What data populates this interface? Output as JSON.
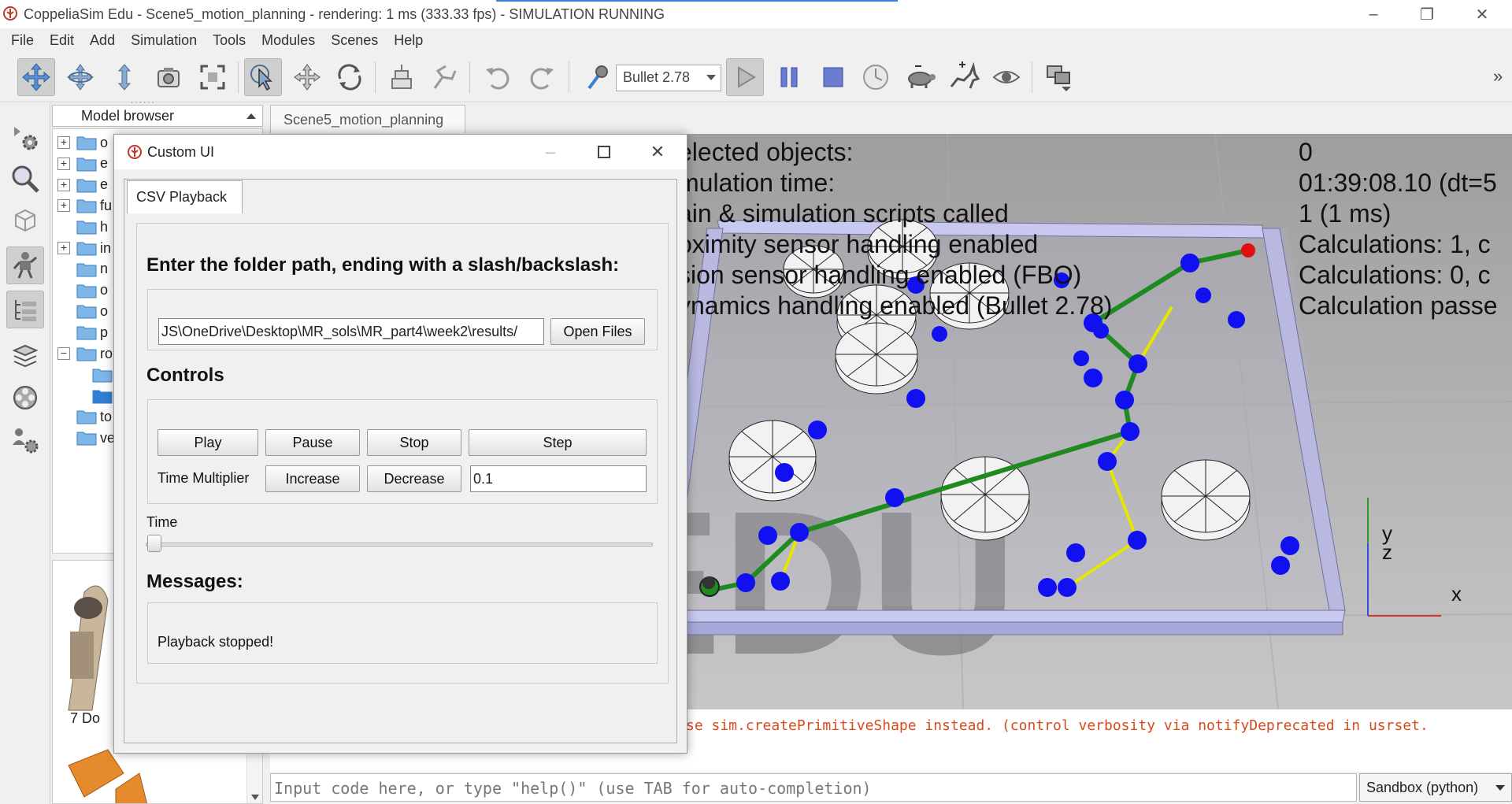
{
  "window": {
    "title": "CoppeliaSim Edu - Scene5_motion_planning - rendering: 1 ms (333.33 fps) - SIMULATION RUNNING",
    "minimize_glyph": "–",
    "restore_glyph": "❐",
    "close_glyph": "✕"
  },
  "menubar": {
    "items": [
      "File",
      "Edit",
      "Add",
      "Simulation",
      "Tools",
      "Modules",
      "Scenes",
      "Help"
    ]
  },
  "toolbar": {
    "physics_engine": "Bullet 2.78",
    "overflow_glyph": "»",
    "icons": [
      "move-view-icon",
      "rotate-view-icon",
      "shift-view-icon",
      "camera-icon",
      "fit-view-icon",
      "select-icon",
      "object-shift-icon",
      "object-rotate-icon",
      "assemble-icon",
      "transfer-dna-icon",
      "undo-icon",
      "redo-icon",
      "dynamic-content-icon",
      "play-icon",
      "pause-icon",
      "stop-icon",
      "real-time-icon",
      "slow-down-icon",
      "speed-up-icon",
      "visualization-icon",
      "page-selector-icon"
    ]
  },
  "model_browser": {
    "header": "Model browser",
    "tree": [
      {
        "label": "o",
        "expandable": "plus"
      },
      {
        "label": "e",
        "expandable": "plus"
      },
      {
        "label": "e",
        "expandable": "plus"
      },
      {
        "label": "fu",
        "expandable": "plus"
      },
      {
        "label": "h",
        "expandable": "none"
      },
      {
        "label": "in",
        "expandable": "plus"
      },
      {
        "label": "n",
        "expandable": "none"
      },
      {
        "label": "o",
        "expandable": "none"
      },
      {
        "label": "o",
        "expandable": "none"
      },
      {
        "label": "p",
        "expandable": "none"
      },
      {
        "label": "ro",
        "expandable": "minus"
      },
      {
        "label": "",
        "expandable": "child"
      },
      {
        "label": "",
        "expandable": "child-selected"
      },
      {
        "label": "to",
        "expandable": "none"
      },
      {
        "label": "ve",
        "expandable": "none"
      }
    ],
    "thumbnail_label": "7 Do"
  },
  "scene_tab": "Scene5_motion_planning",
  "viewport": {
    "info_left": [
      "elected objects:",
      "mulation time:",
      "ain & simulation scripts called",
      "oximity sensor handling enabled",
      "sion sensor handling enabled (FBO)",
      "ynamics handling enabled (Bullet 2.78)"
    ],
    "info_right": [
      "0",
      "01:39:08.10 (dt=5",
      "1 (1 ms)",
      "Calculations: 1, c",
      "Calculations: 0, c",
      "Calculation passe"
    ],
    "watermark": "EDU",
    "axis_y": "y",
    "axis_z": "z",
    "axis_x": "x"
  },
  "console": {
    "message": "se sim.createPrimitiveShape instead. (control verbosity via notifyDeprecated in usrset.",
    "input_placeholder": "Input code here, or type \"help()\" (use TAB for auto-completion)",
    "sandbox": "Sandbox (python)"
  },
  "dialog": {
    "title": "Custom UI",
    "tab": "CSV Playback",
    "folder_prompt": "Enter the folder path, ending with a slash/backslash:",
    "folder_path": "JS\\OneDrive\\Desktop\\MR_sols\\MR_part4\\week2\\results/",
    "open_files": "Open Files",
    "controls_heading": "Controls",
    "play": "Play",
    "pause": "Pause",
    "stop": "Stop",
    "step": "Step",
    "time_multiplier_label": "Time Multiplier",
    "increase": "Increase",
    "decrease": "Decrease",
    "multiplier_value": "0.1",
    "time_label": "Time",
    "time_slider_value": 0,
    "messages_heading": "Messages:",
    "message_text": "Playback stopped!"
  },
  "colors": {
    "accent": "#3c7fd6",
    "path_green": "#1f8a1f",
    "path_yellow": "#e6e600",
    "node_blue": "#1010f0",
    "goal_red": "#e01010",
    "wall": "#b8b8e0",
    "console_text": "#d84a1b"
  }
}
